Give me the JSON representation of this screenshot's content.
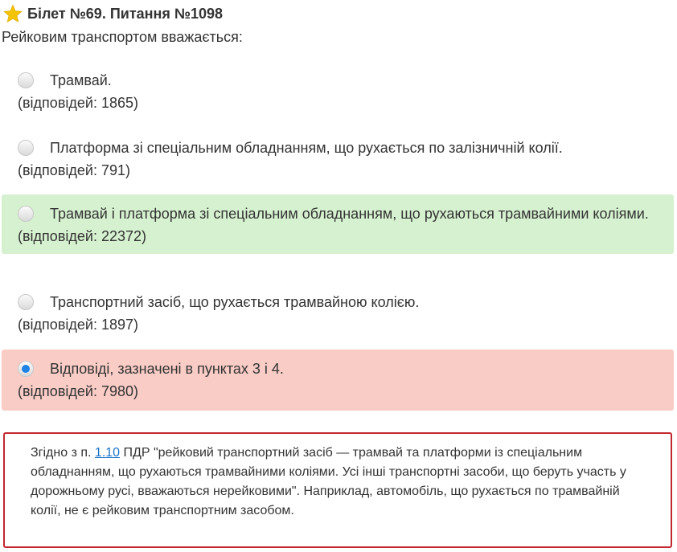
{
  "header": {
    "title": "Білет №69. Питання №1098",
    "star_icon": "star-icon",
    "star_color": "#f5c400"
  },
  "question": "Рейковим транспортом вважається:",
  "answers": [
    {
      "text": "Трамвай.",
      "count": "(відповідей: 1865)",
      "state": "none"
    },
    {
      "text": "Платформа зі спеціальним обладнанням, що рухається по залізничній колії.",
      "count": "(відповідей: 791)",
      "state": "none"
    },
    {
      "text": "Трамвай і платформа зі спеціальним обладнанням, що рухаються трамвайними коліями.",
      "count": "(відповідей: 22372)",
      "state": "correct"
    },
    {
      "text": "Транспортний засіб, що рухається трамвайною колією.",
      "count": "(відповідей: 1897)",
      "state": "none"
    },
    {
      "text": "Відповіді, зазначені в пунктах 3 і 4.",
      "count": "(відповідей: 7980)",
      "state": "wrong-selected"
    }
  ],
  "explanation": {
    "prefix": "Згідно з п.",
    "link": "1.10",
    "text": "ПДР \"рейковий транспортний засіб — трамвай та платформи із спеціальним обладнанням, що рухаються трамвайними коліями. Усі інші транспортні засоби, що беруть участь у дорожньому русі, вважаються нерейковими\". Наприклад, автомобіль, що рухається по трамвайній колії, не є рейковим транспортним засобом."
  },
  "colors": {
    "correct_bg": "#d6f1cf",
    "wrong_bg": "#f9ccc6",
    "explain_border": "#c3272f",
    "link": "#1a73c9",
    "radio_checked": "#1e82e6"
  }
}
